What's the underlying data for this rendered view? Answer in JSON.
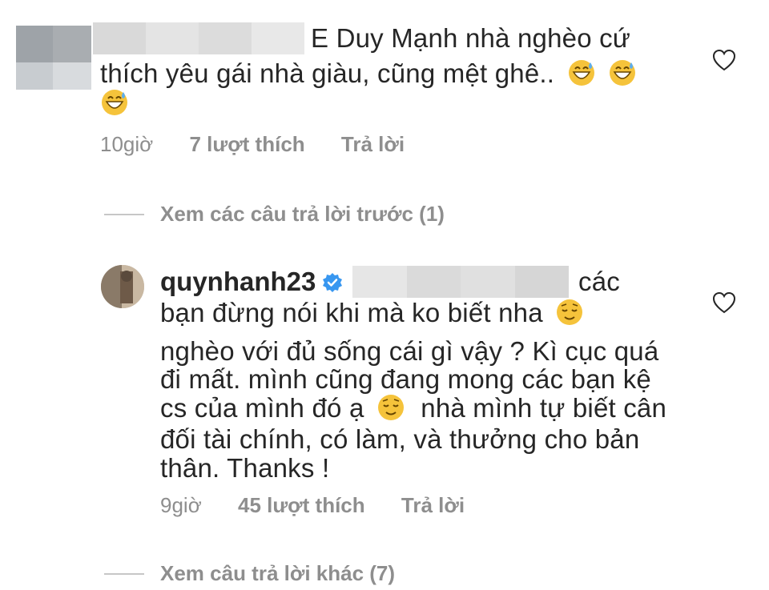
{
  "comment1": {
    "text_line1": "E Duy Mạnh nhà nghèo cứ",
    "text_line2": "thích yêu gái nhà giàu, cũng mệt ghê..",
    "time": "10giờ",
    "likes": "7 lượt thích",
    "reply": "Trả lời",
    "emoji_icon": "grinning-sweat-emoji-icon"
  },
  "view_previous_replies": "Xem các câu trả lời trước (1)",
  "comment2": {
    "username": "quynhanh23",
    "text_line0": "các",
    "text_line1": "bạn đừng nói khi mà ko biết nha",
    "text_line2": "nghèo với đủ sống cái gì vậy ? Kì cục quá",
    "text_line3": "đi mất. mình cũng đang mong các bạn kệ",
    "text_line4a": "cs của mình đó ạ",
    "text_line4b": "nhà mình tự biết cân",
    "text_line5": "đối tài chính, có làm, và thưởng cho bản",
    "text_line6": "thân. Thanks !",
    "time": "9giờ",
    "likes": "45 lượt thích",
    "reply": "Trả lời",
    "emoji_icon": "relieved-face-emoji-icon"
  },
  "view_more_replies": "Xem câu trả lời khác (7)",
  "colors": {
    "text": "#262626",
    "meta": "#8e8e8e",
    "verified": "#3897f0",
    "emoji": "#f5c33b"
  }
}
